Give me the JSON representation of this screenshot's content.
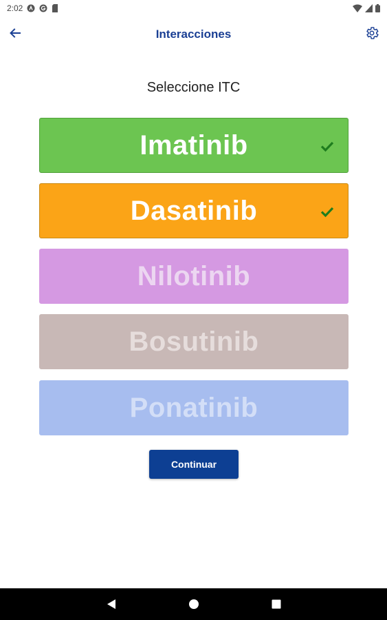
{
  "status_bar": {
    "time": "2:02",
    "icons_left": [
      "a-circle-icon",
      "g-circle-icon",
      "sd-card-icon"
    ],
    "icons_right": [
      "wifi-icon",
      "signal-icon",
      "battery-icon"
    ]
  },
  "app_bar": {
    "title": "Interacciones",
    "back_icon": "arrow-left-icon",
    "settings_icon": "gear-icon",
    "accent_color": "#1a3f94"
  },
  "main": {
    "prompt": "Seleccione ITC",
    "options": [
      {
        "label": "Imatinib",
        "bg": "#6cc551",
        "border": "#4fa03a",
        "text_color": "#ffffff",
        "selected": true,
        "check_color": "#1e7d1e"
      },
      {
        "label": "Dasatinib",
        "bg": "#fba417",
        "border": "#c98a15",
        "text_color": "#ffffff",
        "selected": true,
        "check_color": "#1e7d1e"
      },
      {
        "label": "Nilotinib",
        "bg": "#d599e2",
        "border": "#d599e2",
        "text_color": "#ecd6f1",
        "selected": false
      },
      {
        "label": "Bosutinib",
        "bg": "#c8b8b6",
        "border": "#c8b8b6",
        "text_color": "#e6dddc",
        "selected": false
      },
      {
        "label": "Ponatinib",
        "bg": "#a7bdef",
        "border": "#a7bdef",
        "text_color": "#d3def7",
        "selected": false
      }
    ],
    "continue_label": "Continuar",
    "continue_color": "#0d3f93"
  },
  "nav_bar": {
    "buttons": [
      "back-triangle-icon",
      "home-circle-icon",
      "recents-square-icon"
    ]
  }
}
